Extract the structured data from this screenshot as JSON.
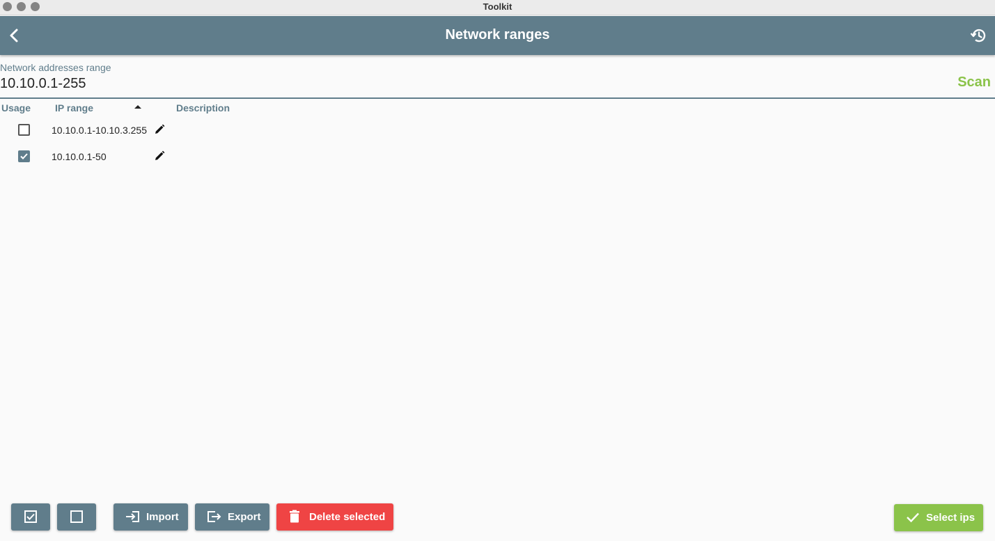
{
  "window": {
    "title": "Toolkit"
  },
  "appbar": {
    "title": "Network ranges",
    "back_icon": "arrow-back-icon",
    "history_icon": "history-icon"
  },
  "range_field": {
    "label": "Network addresses range",
    "value": "10.10.0.1-255",
    "scan_label": "Scan"
  },
  "table": {
    "headers": {
      "usage": "Usage",
      "ip_range": "IP range",
      "description": "Description"
    },
    "sort": {
      "column": "ip_range",
      "direction": "ascending"
    },
    "rows": [
      {
        "usage": false,
        "ip_range": "10.10.0.1-10.10.3.255",
        "description": ""
      },
      {
        "usage": true,
        "ip_range": "10.10.0.1-50",
        "description": ""
      }
    ]
  },
  "footer": {
    "import_label": "Import",
    "export_label": "Export",
    "delete_label": "Delete selected",
    "select_label": "Select ips"
  },
  "colors": {
    "primary": "#607d8b",
    "accent": "#8bc34a",
    "danger": "#ef4444"
  }
}
